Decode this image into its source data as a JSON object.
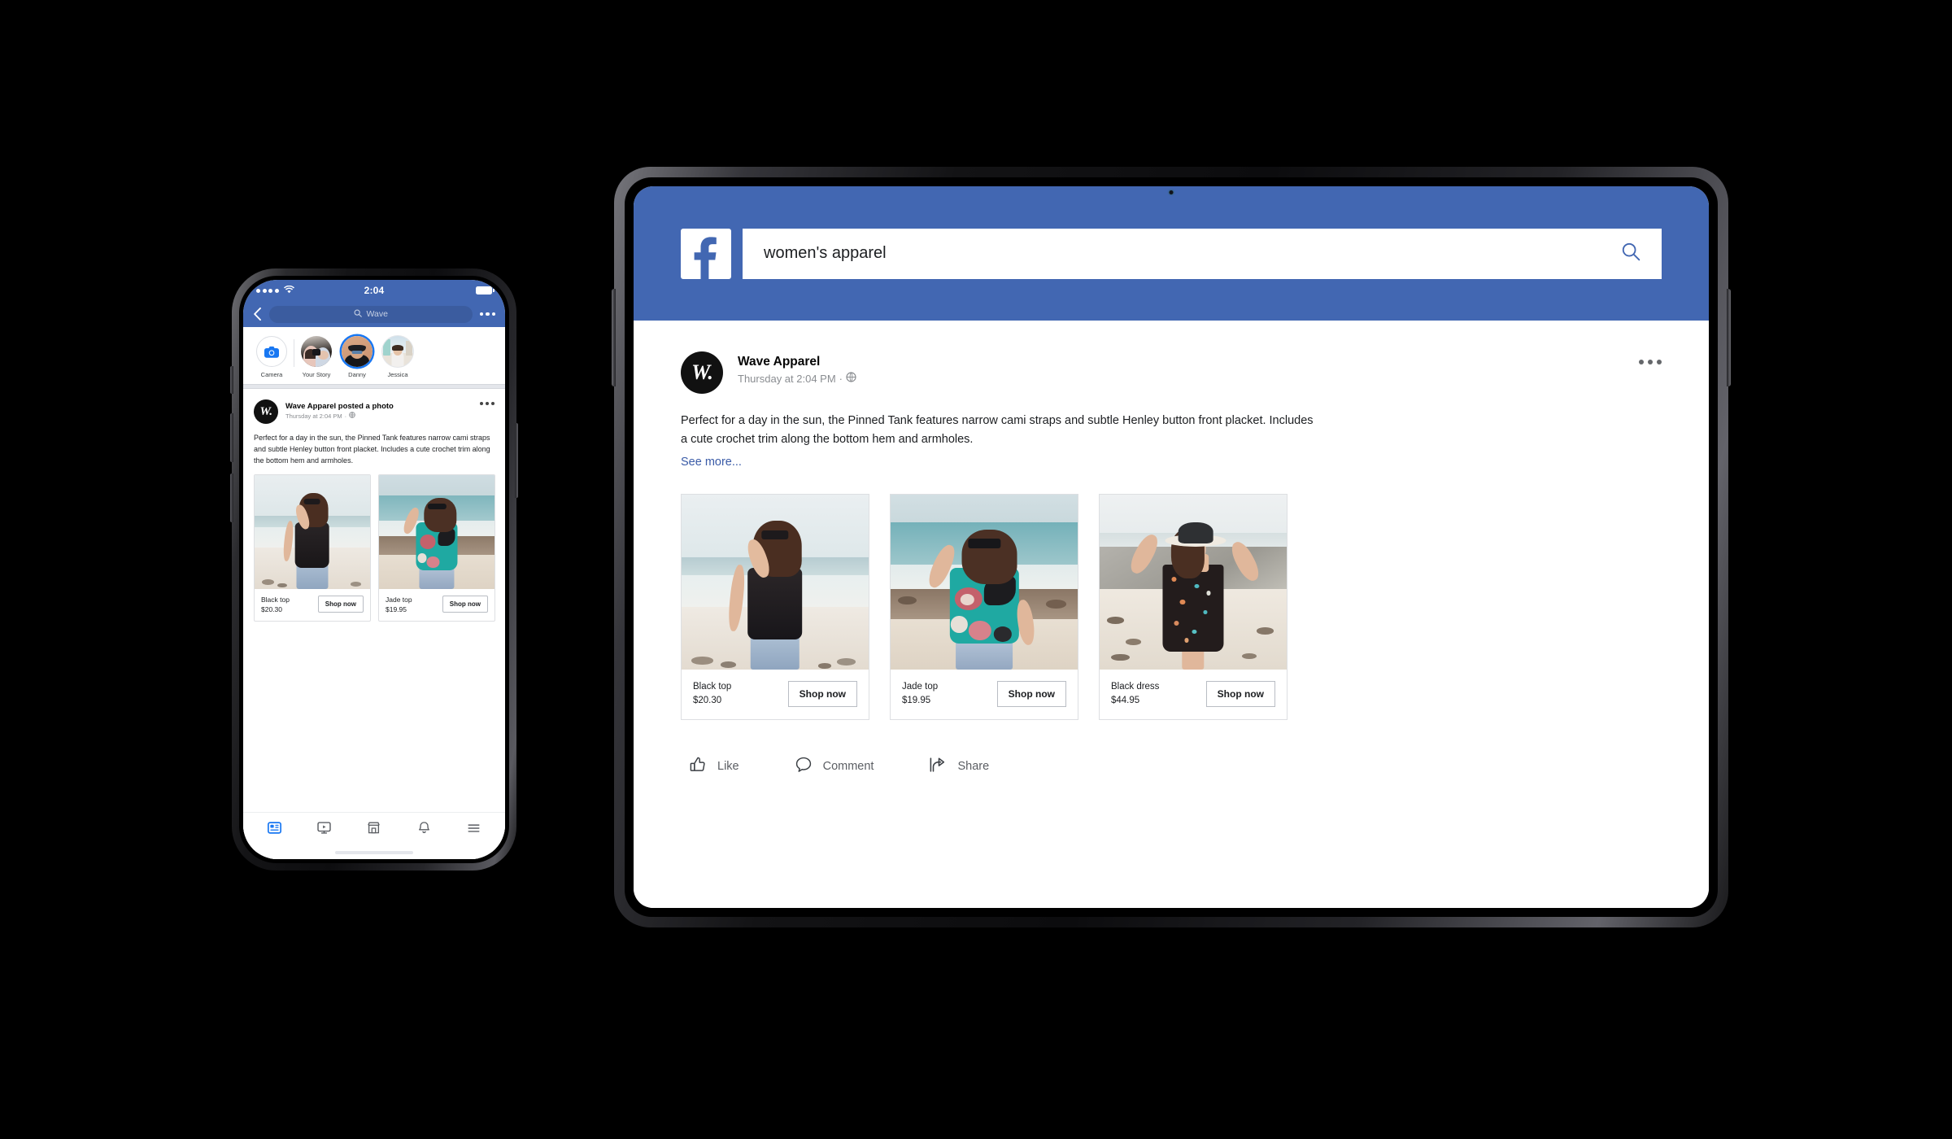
{
  "phone": {
    "status_bar": {
      "time": "2:04",
      "signal_icon": "signal-dots-icon",
      "wifi_icon": "wifi-icon",
      "battery_icon": "battery-icon"
    },
    "nav": {
      "back_icon": "chevron-left-icon",
      "search_icon": "search-icon",
      "search_value": "Wave",
      "more_icon": "more-horizontal-icon"
    },
    "stories": [
      {
        "label": "Camera",
        "type": "camera"
      },
      {
        "label": "Your Story",
        "type": "add"
      },
      {
        "label": "Danny",
        "type": "ring"
      },
      {
        "label": "Jessica",
        "type": "plain"
      }
    ],
    "post": {
      "author": "Wave Apparel posted a photo",
      "timestamp": "Thursday at 2:04 PM",
      "privacy_icon": "globe-icon",
      "avatar_mark": "W.",
      "more_icon": "more-horizontal-icon",
      "body": "Perfect for a day in the sun, the Pinned Tank features narrow cami straps and subtle Henley button front placket. Includes a cute crochet trim along the bottom hem and armholes."
    },
    "products": [
      {
        "name": "Black top",
        "price": "$20.30",
        "cta": "Shop now",
        "image": "woman-black-tank-beach"
      },
      {
        "name": "Jade top",
        "price": "$19.95",
        "cta": "Shop now",
        "image": "woman-jade-floral-top-beach"
      }
    ],
    "tabbar": [
      {
        "icon": "news-feed-icon",
        "active": true
      },
      {
        "icon": "watch-video-icon",
        "active": false
      },
      {
        "icon": "marketplace-icon",
        "active": false
      },
      {
        "icon": "notifications-bell-icon",
        "active": false
      },
      {
        "icon": "menu-hamburger-icon",
        "active": false
      }
    ]
  },
  "tablet": {
    "header": {
      "logo_icon": "facebook-logo-icon",
      "search_value": "women's apparel",
      "search_icon": "search-icon"
    },
    "post": {
      "author": "Wave Apparel",
      "timestamp": "Thursday at 2:04 PM",
      "privacy_icon": "globe-icon",
      "avatar_mark": "W.",
      "more_icon": "more-horizontal-icon",
      "body": "Perfect for a day in the sun, the Pinned Tank features narrow cami straps and subtle Henley button front placket. Includes a cute crochet trim along the bottom hem and armholes.",
      "see_more": "See more..."
    },
    "products": [
      {
        "name": "Black top",
        "price": "$20.30",
        "cta": "Shop now",
        "image": "woman-black-tank-beach"
      },
      {
        "name": "Jade top",
        "price": "$19.95",
        "cta": "Shop now",
        "image": "woman-jade-floral-top-beach"
      },
      {
        "name": "Black dress",
        "price": "$44.95",
        "cta": "Shop now",
        "image": "woman-black-floral-dress-hat-beach"
      }
    ],
    "actions": [
      {
        "label": "Like",
        "icon": "thumbs-up-icon"
      },
      {
        "label": "Comment",
        "icon": "comment-bubble-icon"
      },
      {
        "label": "Share",
        "icon": "share-arrow-icon"
      }
    ]
  },
  "colors": {
    "facebook_blue": "#4267B2",
    "link_blue": "#3A5BA7",
    "accent_blue": "#1877F2",
    "background": "#000000",
    "card_border": "#dddfe2",
    "muted_text": "#8a8d91"
  }
}
